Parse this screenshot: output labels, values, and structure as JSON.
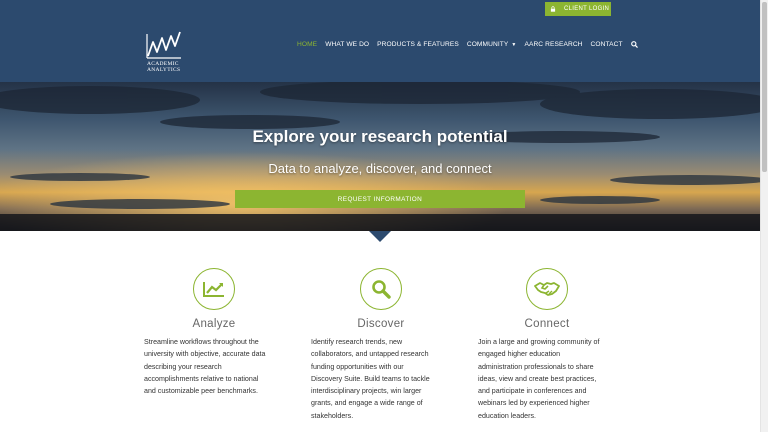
{
  "colors": {
    "header_bg": "#2c4a6e",
    "accent": "#8cb531",
    "text": "#333333"
  },
  "top_bar": {
    "client_login": "CLIENT LOGIN",
    "icon": "lock-icon"
  },
  "logo": {
    "line1": "ACADEMIC",
    "line2": "ANALYTICS"
  },
  "nav": {
    "items": [
      "HOME",
      "WHAT WE DO",
      "PRODUCTS & FEATURES",
      "COMMUNITY",
      "AARC RESEARCH",
      "CONTACT"
    ],
    "active": "HOME",
    "community_dropdown_icon": "chevron-down-icon",
    "search_icon": "search-icon"
  },
  "hero": {
    "title": "Explore your research potential",
    "subtitle": "Data to analyze, discover, and connect",
    "cta": "REQUEST INFORMATION"
  },
  "features": [
    {
      "title": "Analyze",
      "icon": "chart-icon",
      "desc": [
        "Streamline workflows throughout the",
        "university with objective, accurate data",
        "describing your research",
        "accomplishments relative to national",
        "and customizable peer benchmarks."
      ]
    },
    {
      "title": "Discover",
      "icon": "search-icon",
      "desc": [
        "Identify research trends, new",
        "collaborators, and untapped research",
        "funding opportunities with our",
        "Discovery Suite. Build teams to tackle",
        "interdisciplinary projects, win larger",
        "grants, and engage a wide range of",
        "stakeholders."
      ]
    },
    {
      "title": "Connect",
      "icon": "handshake-icon",
      "desc": [
        "Join a large and growing community of",
        "engaged higher education",
        "administration professionals to share",
        "ideas, view and create best practices,",
        "and participate in conferences and",
        "webinars led by experienced higher",
        "education leaders."
      ]
    }
  ]
}
